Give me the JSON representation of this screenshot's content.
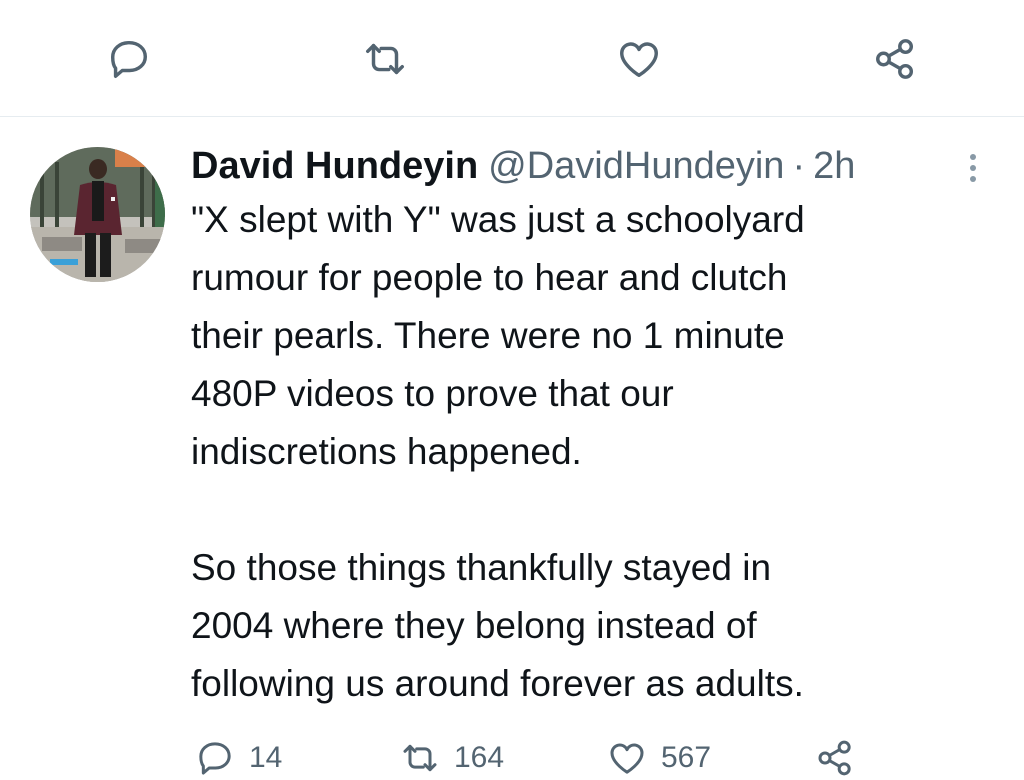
{
  "top_actions": [
    {
      "name": "reply-icon"
    },
    {
      "name": "retweet-icon"
    },
    {
      "name": "like-icon"
    },
    {
      "name": "share-icon"
    }
  ],
  "tweet": {
    "author": {
      "display_name": "David Hundeyin",
      "handle": "@DavidHundeyin",
      "separator": "·",
      "time": "2h"
    },
    "body_lines": [
      "\"X slept with Y\" was just a schoolyard",
      "rumour for people to hear and clutch",
      "their pearls. There were no 1 minute",
      "480P videos to prove that our",
      "indiscretions happened.",
      "",
      "So those things thankfully stayed in",
      "2004 where they belong instead of",
      "following us around forever as adults."
    ],
    "stats": {
      "replies": "14",
      "retweets": "164",
      "likes": "567"
    }
  },
  "colors": {
    "icon_gray": "#536471",
    "text_primary": "#0f1419",
    "divider": "#e6ecf0"
  }
}
